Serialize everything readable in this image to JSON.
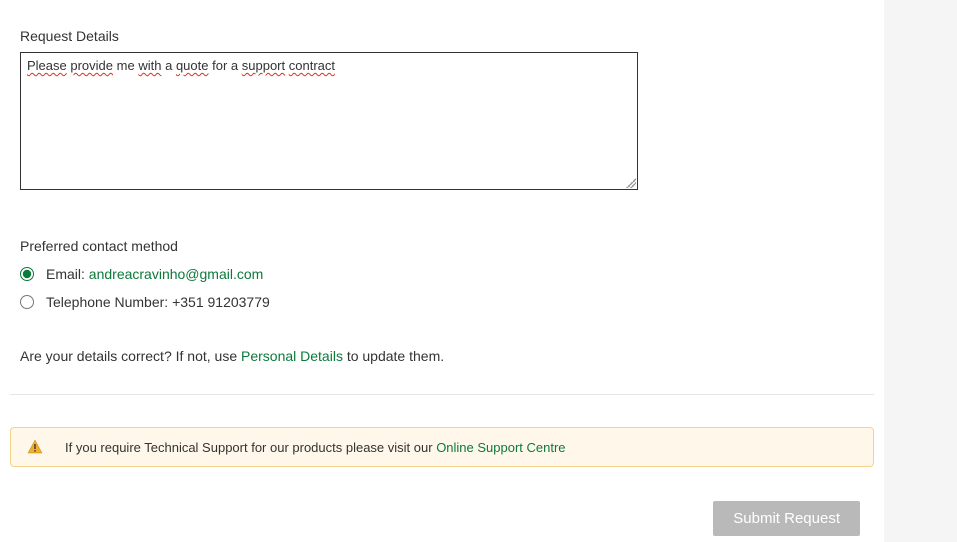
{
  "request": {
    "label": "Request Details",
    "value": "Please provide me with a quote for a support contract",
    "wavy_words": [
      "Please",
      "provide",
      "with",
      "quote",
      "support",
      "contract"
    ]
  },
  "contact": {
    "label": "Preferred contact method",
    "options": [
      {
        "type": "email",
        "prefix": "Email: ",
        "value": "andreacravinho@gmail.com",
        "selected": true
      },
      {
        "type": "telephone",
        "prefix": "Telephone Number: ",
        "value": "+351 91203779",
        "selected": false
      }
    ]
  },
  "details_prompt": {
    "before": "Are your details correct? If not, use ",
    "link": "Personal Details",
    "after": " to update them."
  },
  "alert": {
    "before": "If you require Technical Support for our products please visit our ",
    "link": "Online Support Centre"
  },
  "submit": {
    "label": "Submit Request"
  }
}
